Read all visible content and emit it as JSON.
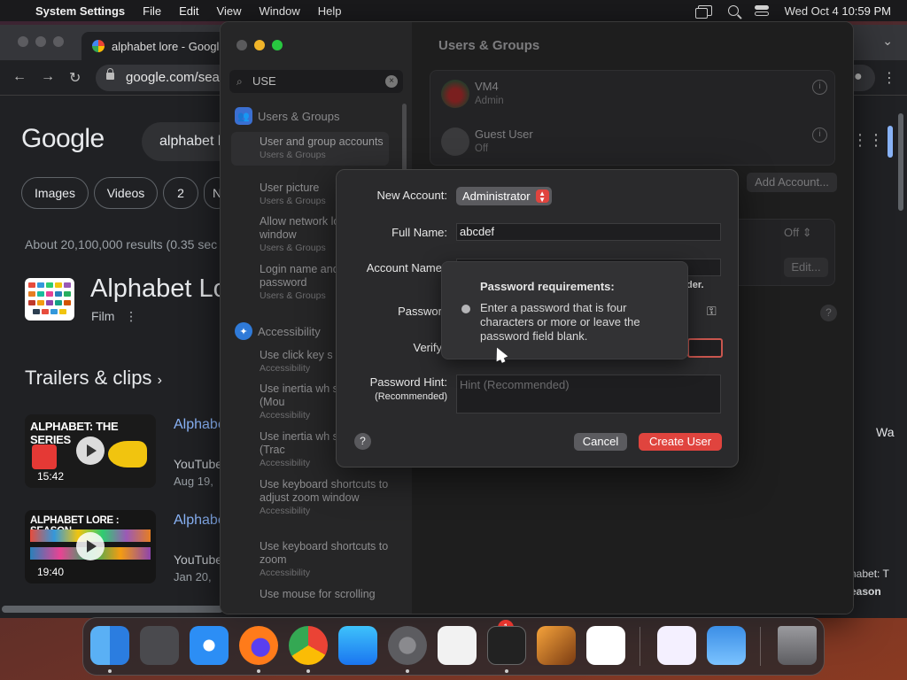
{
  "menubar": {
    "app_name": "System Settings",
    "items": [
      "File",
      "Edit",
      "View",
      "Window",
      "Help"
    ],
    "datetime": "Wed Oct 4  10:59 PM"
  },
  "browser": {
    "tab_title": "alphabet lore - Googl",
    "url": "google.com/sea",
    "logo": "Google",
    "query": "alphabet l",
    "chips": [
      "Images",
      "Videos",
      "2",
      "N"
    ],
    "result_count": "About 20,100,000 results (0.35 sec",
    "kp_title": "Alphabet Lo",
    "kp_subtitle": "Film",
    "kp_more": "⋮",
    "trailers_heading": "Trailers & clips",
    "videos": [
      {
        "thumb_text": "ALPHABET: THE SERIES",
        "duration": "15:42",
        "title": "Alphabe",
        "source": "YouTube",
        "date": "Aug 19,"
      },
      {
        "thumb_text": "ALPHABET LORE : SEASON",
        "duration": "19:40",
        "title": "Alphabe",
        "source": "YouTube",
        "date": "Jan 20,"
      }
    ],
    "right_text_1": "Wa",
    "right_text_2": "habet: T",
    "right_text_3": "eason"
  },
  "settings": {
    "search_value": "USE",
    "section_users": "Users & Groups",
    "section_accessibility": "Accessibility",
    "results": [
      {
        "title": "User and group accounts",
        "category": "Users & Groups"
      },
      {
        "title": "User picture",
        "category": "Users & Groups"
      },
      {
        "title": "Allow network login window",
        "category": "Users & Groups"
      },
      {
        "title": "Login name and password",
        "category": "Users & Groups"
      },
      {
        "title": "Use click key s",
        "category": "Accessibility"
      },
      {
        "title": "Use inertia wh scrolling (Mou",
        "category": "Accessibility"
      },
      {
        "title": "Use inertia wh scrolling (Trac",
        "category": "Accessibility"
      },
      {
        "title": "Use keyboard shortcuts to adjust zoom window",
        "category": "Accessibility"
      },
      {
        "title": "Use keyboard shortcuts to zoom",
        "category": "Accessibility"
      },
      {
        "title": "Use mouse for scrolling",
        "category": ""
      }
    ],
    "main_title": "Users & Groups",
    "users": [
      {
        "name": "VM4",
        "role": "Admin"
      },
      {
        "name": "Guest User",
        "role": "Off"
      }
    ],
    "add_account": "Add Account...",
    "off_value": "Off",
    "edit_label": "Edit...",
    "help": "?"
  },
  "dialog": {
    "new_account_label": "New Account:",
    "account_type": "Administrator",
    "full_name_label": "Full Name:",
    "full_name_value": "abcdef",
    "account_name_label": "Account Name",
    "account_name_note": "der.",
    "password_label": "Passwor",
    "verify_label": "Verify",
    "hint_label": "Password Hint:",
    "hint_sub": "(Recommended)",
    "hint_placeholder": "Hint (Recommended)",
    "help": "?",
    "cancel": "Cancel",
    "create": "Create User"
  },
  "popover": {
    "title": "Password requirements:",
    "text": "Enter a password that is four characters or more or leave the password field blank."
  },
  "dock": {
    "badge": "1"
  },
  "colors": {
    "accent_red": "#e0443e",
    "link_blue": "#8ab4f8"
  }
}
